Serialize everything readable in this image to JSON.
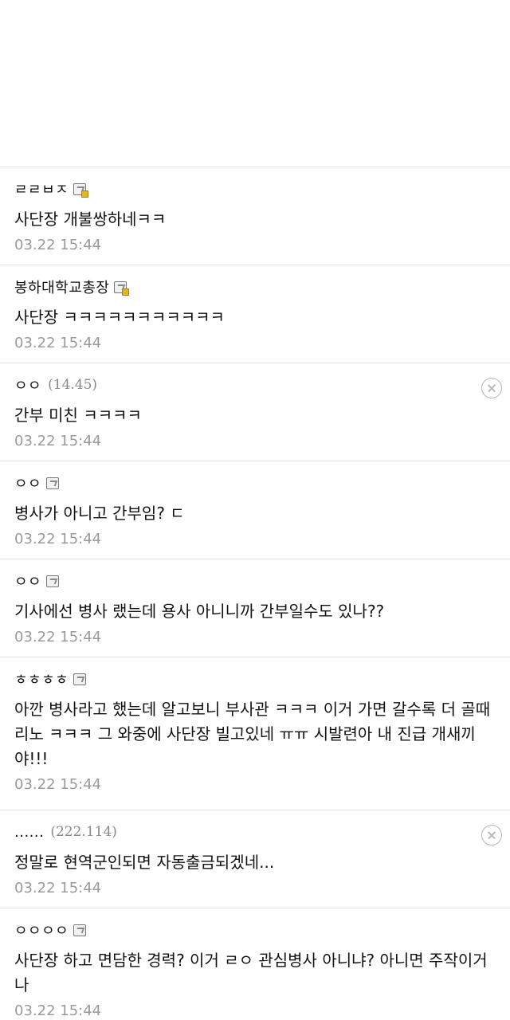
{
  "comments": [
    {
      "author": "ㄹㄹㅂㅈ",
      "ip": "",
      "content": "사단장 개불쌍하네ㅋㅋ",
      "date": "03.22 15:44"
    },
    {
      "author": "봉하대학교총장",
      "ip": "",
      "content": "사단장 ㅋㅋㅋㅋㅋㅋㅋㅋㅋㅋㅋ",
      "date": "03.22 15:44"
    },
    {
      "author": "ㅇㅇ",
      "ip": "(14.45)",
      "content": "간부 미친 ㅋㅋㅋㅋ",
      "date": "03.22 15:44"
    },
    {
      "author": "ㅇㅇ",
      "ip": "",
      "content": "병사가 아니고 간부임? ㄷ",
      "date": "03.22 15:44"
    },
    {
      "author": "ㅇㅇ",
      "ip": "",
      "content": "기사에선 병사 랬는데 용사 아니니까 간부일수도 있나??",
      "date": "03.22 15:44"
    },
    {
      "author": "ㅎㅎㅎㅎ",
      "ip": "",
      "content": "아깐 병사라고 했는데 알고보니 부사관 ㅋㅋㅋ 이거 가면 갈수록 더 골때리노 ㅋㅋㅋ 그 와중에 사단장 빌고있네 ㅠㅠ 시발련아 내 진급 개새끼야!!!",
      "date": "03.22 15:44"
    },
    {
      "author": "......",
      "ip": "(222.114)",
      "content": "정말로 현역군인되면 자동출금되겠네...",
      "date": "03.22 15:44"
    },
    {
      "author": "ㅇㅇㅇㅇ",
      "ip": "",
      "content": "사단장 하고 면담한 경력? 이거 ㄹㅇ 관심병사 아니냐? 아니면 주작이거나",
      "date": "03.22 15:44"
    }
  ],
  "icons": {
    "member_icon": "member-badge-icon",
    "gold_member_icon": "gold-member-badge-icon",
    "delete_icon": "circle-x-icon"
  }
}
